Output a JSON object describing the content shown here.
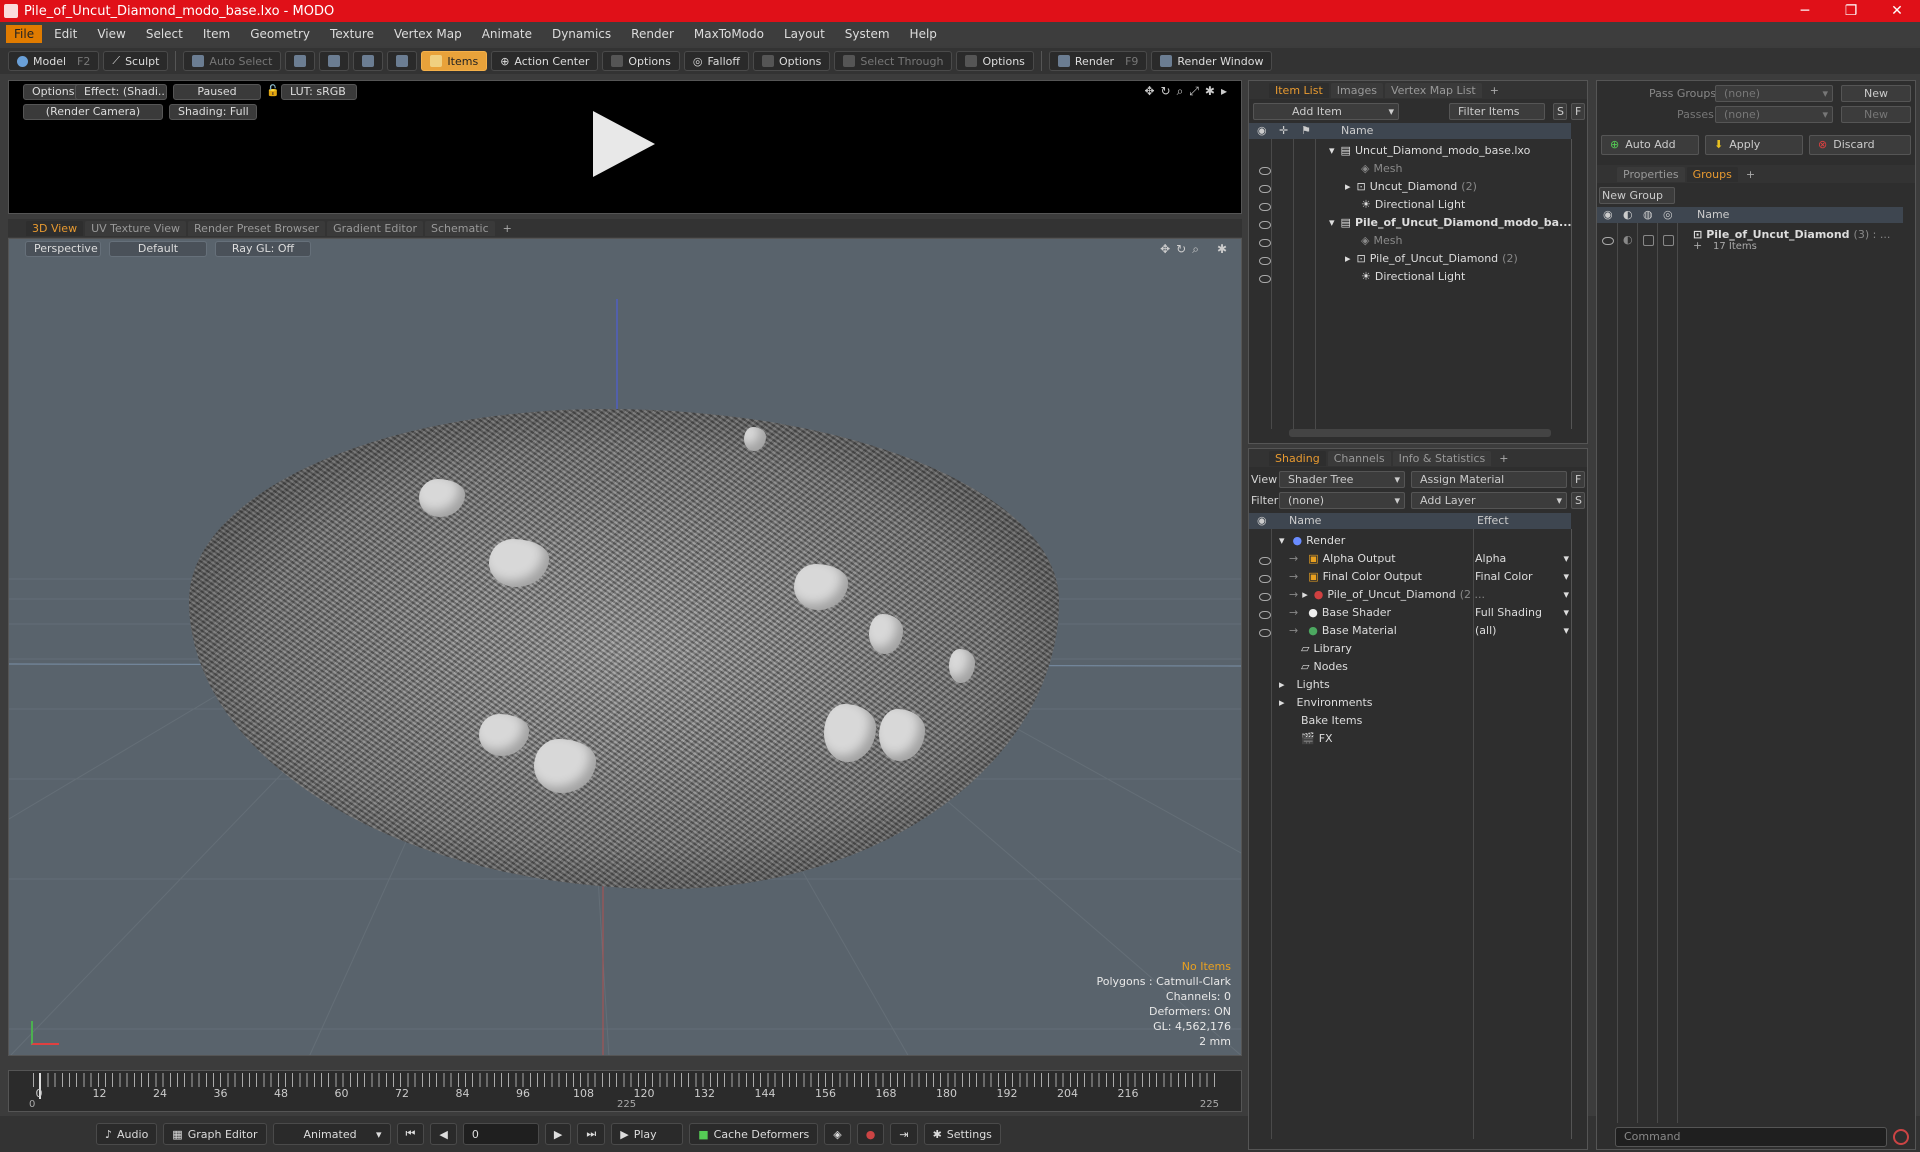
{
  "window": {
    "title": "Pile_of_Uncut_Diamond_modo_base.lxo - MODO",
    "controls": [
      "─",
      "❐",
      "✕"
    ]
  },
  "menu": [
    "File",
    "Edit",
    "View",
    "Select",
    "Item",
    "Geometry",
    "Texture",
    "Vertex Map",
    "Animate",
    "Dynamics",
    "Render",
    "MaxToModo",
    "Layout",
    "System",
    "Help"
  ],
  "toolbar": {
    "model": "Model",
    "model_key": "F2",
    "sculpt": "Sculpt",
    "auto_select": "Auto Select",
    "items": "Items",
    "action_center": "Action Center",
    "options1": "Options",
    "falloff": "Falloff",
    "options2": "Options",
    "select_through": "Select Through",
    "options3": "Options",
    "render": "Render",
    "render_key": "F9",
    "render_window": "Render Window"
  },
  "render_preview": {
    "options": "Options",
    "effect": "Effect: (Shadi...",
    "paused": "Paused",
    "lut": "LUT: sRGB",
    "camera": "(Render Camera)",
    "shading": "Shading: Full"
  },
  "view_tabs": [
    "3D View",
    "UV Texture View",
    "Render Preset Browser",
    "Gradient Editor",
    "Schematic",
    "+"
  ],
  "viewport": {
    "perspective": "Perspective",
    "default": "Default",
    "raygl": "Ray GL: Off",
    "stats": {
      "items": "No Items",
      "polygons": "Polygons : Catmull-Clark",
      "channels": "Channels: 0",
      "deformers": "Deformers: ON",
      "gl": "GL: 4,562,176",
      "scale": "2 mm"
    }
  },
  "timeline": {
    "labels": [
      "0",
      "12",
      "24",
      "36",
      "48",
      "60",
      "72",
      "84",
      "96",
      "108",
      "120",
      "132",
      "144",
      "156",
      "168",
      "180",
      "192",
      "204",
      "216"
    ],
    "start": "0",
    "mid": "225",
    "end": "225"
  },
  "bottombar": {
    "audio": "Audio",
    "graph_editor": "Graph Editor",
    "animated": "Animated",
    "frame": "0",
    "play": "Play",
    "cache": "Cache Deformers",
    "settings": "Settings"
  },
  "itemlist": {
    "tabs": [
      "Item List",
      "Images",
      "Vertex Map List",
      "+"
    ],
    "add_item": "Add Item",
    "filter": "Filter Items",
    "s": "S",
    "f": "F",
    "col_name": "Name",
    "rows": [
      {
        "label": "Uncut_Diamond_modo_base.lxo",
        "count": "",
        "bold": false
      },
      {
        "label": "Mesh",
        "count": "",
        "bold": false
      },
      {
        "label": "Uncut_Diamond",
        "count": "(2)",
        "bold": false
      },
      {
        "label": "Directional Light",
        "count": "",
        "bold": false
      },
      {
        "label": "Pile_of_Uncut_Diamond_modo_ba...",
        "count": "",
        "bold": true
      },
      {
        "label": "Mesh",
        "count": "",
        "bold": false
      },
      {
        "label": "Pile_of_Uncut_Diamond",
        "count": "(2)",
        "bold": false
      },
      {
        "label": "Directional Light",
        "count": "",
        "bold": false
      }
    ]
  },
  "shading": {
    "tabs": [
      "Shading",
      "Channels",
      "Info & Statistics",
      "+"
    ],
    "view_label": "View",
    "view_value": "Shader Tree",
    "assign": "Assign Material",
    "f": "F",
    "filter_label": "Filter",
    "filter_value": "(none)",
    "add_layer": "Add Layer",
    "s": "S",
    "col_name": "Name",
    "col_effect": "Effect",
    "rows": [
      {
        "label": "Render",
        "effect": ""
      },
      {
        "label": "Alpha Output",
        "effect": "Alpha"
      },
      {
        "label": "Final Color Output",
        "effect": "Final Color"
      },
      {
        "label": "Pile_of_Uncut_Diamond",
        "suffix": "(2 ...",
        "effect": ""
      },
      {
        "label": "Base Shader",
        "effect": "Full Shading"
      },
      {
        "label": "Base Material",
        "effect": "(all)"
      },
      {
        "label": "Library",
        "effect": ""
      },
      {
        "label": "Nodes",
        "effect": ""
      },
      {
        "label": "Lights",
        "effect": ""
      },
      {
        "label": "Environments",
        "effect": ""
      },
      {
        "label": "Bake Items",
        "effect": ""
      },
      {
        "label": "FX",
        "effect": ""
      }
    ]
  },
  "groups": {
    "pass_groups": "Pass Groups",
    "pass_value": "(none)",
    "new1": "New",
    "passes": "Passes",
    "passes_value": "(none)",
    "new2": "New",
    "auto_add": "Auto Add",
    "apply": "Apply",
    "discard": "Discard",
    "tabs": [
      "Properties",
      "Groups",
      "+"
    ],
    "new_group": "New Group",
    "col_name": "Name",
    "group_name": "Pile_of_Uncut_Diamond",
    "group_count": "(3) : ...",
    "group_items": "17 Items"
  },
  "command": {
    "placeholder": "Command"
  }
}
